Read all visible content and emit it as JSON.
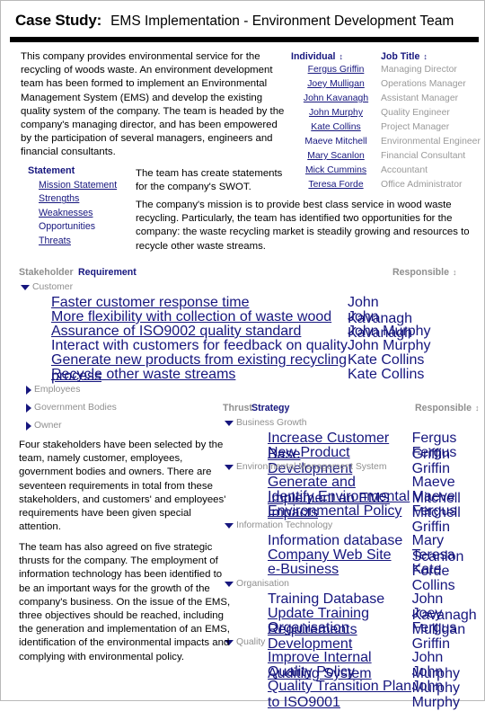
{
  "title": {
    "label": "Case Study:",
    "text": "EMS Implementation - Environment Development Team"
  },
  "paragraphs": {
    "intro": "This company provides environmental  service for the recycling of woods waste. An environment development team has been formed to implement an Environmental Management System (EMS) and develop the existing quality system of the company. The team is headed by the company's managing director, and has been empowered by the participation of several managers, engineers and financial consultants.",
    "swot_note": "The team has create statements for the company's SWOT.",
    "mission": "The company's mission is to provide best class service in wood waste recycling. Particularly, the team has identified two opportunities for the company: the waste recycling market is steadily growing and resources to recycle other waste streams.",
    "stakeholders": "Four stakeholders have been selected by the team, namely customer, employees, government bodies and owners. There are seventeen requirements in total from these stakeholders, and customers' and employees' requirements have been given special attention.",
    "thrusts": "The team has also agreed on five strategic thrusts for the company. The employment of information technology has been identified to be an important ways for the growth of the company's business. On the issue of the EMS, three objectives should be reached, including the generation and implementation of an EMS, identification of the environmental impacts and complying with environmental policy."
  },
  "people_table": {
    "columns": [
      "Individual",
      "Job Title"
    ],
    "sort_icon": "sort-updown-icon",
    "rows": [
      {
        "individual": "Fergus Griffin",
        "job_title": "Managing Director"
      },
      {
        "individual": "Joey Mulligan",
        "job_title": "Operations Manager"
      },
      {
        "individual": "John Kavanagh",
        "job_title": "Assistant Manager"
      },
      {
        "individual": "John Murphy",
        "job_title": "Quality Engineer"
      },
      {
        "individual": "Kate Collins",
        "job_title": "Project Manager"
      },
      {
        "individual": "Maeve Mitchell",
        "job_title": "Environmental Engineer"
      },
      {
        "individual": "Mary Scanlon",
        "job_title": "Financial Consultant"
      },
      {
        "individual": "Mick Cummins",
        "job_title": "Accountant"
      },
      {
        "individual": "Teresa Forde",
        "job_title": "Office Administrator"
      }
    ]
  },
  "statement": {
    "header": "Statement",
    "items": [
      "Mission Statement",
      "Strengths",
      "Weaknesses",
      "Opportunities",
      "Threats"
    ]
  },
  "stakeholder_grid": {
    "columns": [
      "Stakeholder",
      "Requirement",
      "Responsible"
    ],
    "sort_icon": "sort-updown-icon",
    "groups": [
      {
        "name": "Customer",
        "expanded": true,
        "triangle": "triangle-down-icon",
        "rows": [
          {
            "requirement": "Faster customer response time",
            "responsible": "John Kavanagh"
          },
          {
            "requirement": "More flexibility with collection of waste wood",
            "responsible": "John Kavanagh"
          },
          {
            "requirement": "Assurance of ISO9002 quality standard",
            "responsible": "John Murphy"
          },
          {
            "requirement": "Interact with customers for feedback on quality",
            "responsible": "John Murphy"
          },
          {
            "requirement": "Generate new products from existing recycling process",
            "responsible": "Kate Collins"
          },
          {
            "requirement": "Recycle other waste streams",
            "responsible": "Kate Collins"
          }
        ]
      },
      {
        "name": "Employees",
        "expanded": false,
        "triangle": "triangle-right-icon",
        "rows": []
      },
      {
        "name": "Government Bodies",
        "expanded": false,
        "triangle": "triangle-right-icon",
        "rows": []
      },
      {
        "name": "Owner",
        "expanded": false,
        "triangle": "triangle-right-icon",
        "rows": []
      }
    ]
  },
  "thrust_grid": {
    "columns": [
      "Thrust",
      "Strategy",
      "Responsible"
    ],
    "sort_icon": "sort-updown-icon",
    "groups": [
      {
        "name": "Business Growth",
        "expanded": true,
        "triangle": "triangle-down-icon",
        "rows": [
          {
            "strategy": "Increase Customer Base",
            "responsible": "Fergus Griffin"
          },
          {
            "strategy": "New Product Development",
            "responsible": "Fergus Griffin"
          }
        ]
      },
      {
        "name": "Environmental Management System",
        "expanded": true,
        "triangle": "triangle-down-icon",
        "rows": [
          {
            "strategy": "Generate and Implement an EMS",
            "responsible": "Maeve Mitchell"
          },
          {
            "strategy": "Identify Environmental Impacts",
            "responsible": "Maeve Mitchell"
          },
          {
            "strategy": "Environmental Policy",
            "responsible": "Fergus Griffin"
          }
        ]
      },
      {
        "name": "Information Technology",
        "expanded": true,
        "triangle": "triangle-down-icon",
        "rows": [
          {
            "strategy": "Information database",
            "responsible": "Mary Scanlon"
          },
          {
            "strategy": "Company Web Site",
            "responsible": "Teresa Forde"
          },
          {
            "strategy": "e-Business",
            "responsible": "Kate Collins"
          }
        ]
      },
      {
        "name": "Organisation",
        "expanded": true,
        "triangle": "triangle-down-icon",
        "rows": [
          {
            "strategy": "Training Database",
            "responsible": "John Kavanagh"
          },
          {
            "strategy": "Update Training Requirements",
            "responsible": "Joey Mulligan"
          },
          {
            "strategy": "Organisation Development",
            "responsible": "Fergus Griffin"
          }
        ]
      },
      {
        "name": "Quality",
        "expanded": true,
        "triangle": "triangle-down-icon",
        "rows": [
          {
            "strategy": "Improve Internal Auditing System",
            "responsible": "John Murphy"
          },
          {
            "strategy": "Quality Policy",
            "responsible": "John Murphy"
          },
          {
            "strategy": "Quality Transition Plan to ISO9001",
            "responsible": "John Murphy"
          }
        ]
      }
    ]
  },
  "colors": {
    "link_navy": "#16167e",
    "muted_grey": "#9a9a9a",
    "rule_black": "#000000"
  }
}
